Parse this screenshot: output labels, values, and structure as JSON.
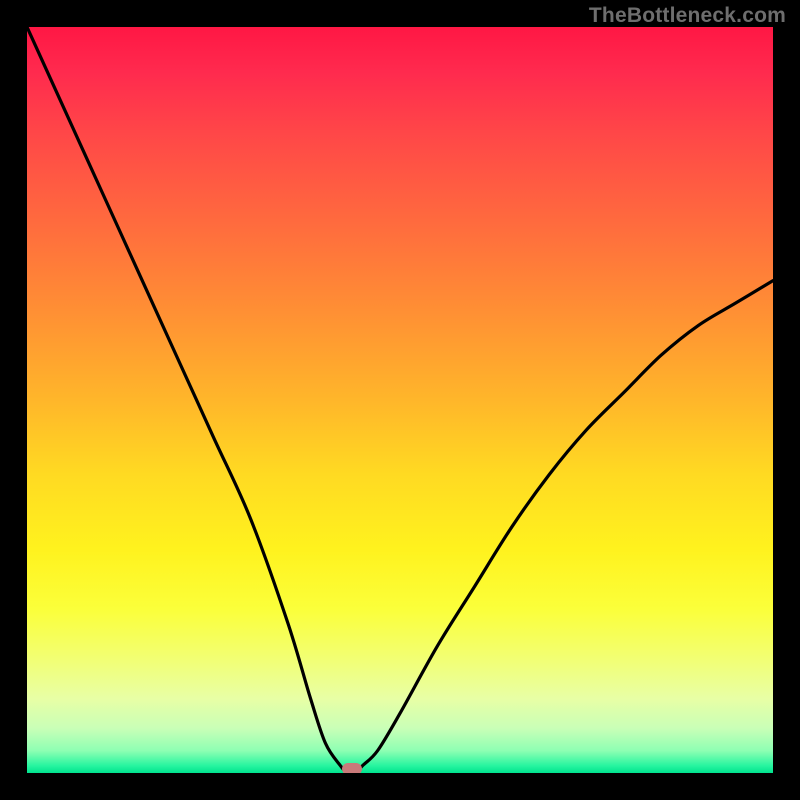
{
  "watermark": "TheBottleneck.com",
  "chart_data": {
    "type": "line",
    "title": "",
    "xlabel": "",
    "ylabel": "",
    "xlim": [
      0,
      100
    ],
    "ylim": [
      0,
      100
    ],
    "x": [
      0,
      5,
      10,
      15,
      20,
      25,
      30,
      35,
      38,
      40,
      42,
      43,
      44,
      45,
      47,
      50,
      55,
      60,
      65,
      70,
      75,
      80,
      85,
      90,
      95,
      100
    ],
    "y": [
      100,
      89,
      78,
      67,
      56,
      45,
      34,
      20,
      10,
      4,
      1,
      0,
      0,
      1,
      3,
      8,
      17,
      25,
      33,
      40,
      46,
      51,
      56,
      60,
      63,
      66
    ],
    "marker": {
      "x": 43.5,
      "y": 0.5
    },
    "colors": {
      "curve": "#000000",
      "marker": "#c97a7a",
      "gradient_top": "#ff1744",
      "gradient_bottom": "#00e38e",
      "frame": "#000000"
    }
  }
}
